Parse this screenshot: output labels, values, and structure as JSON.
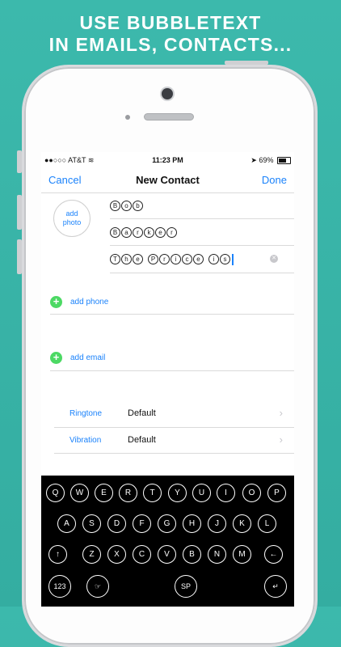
{
  "headline": {
    "line1": "USE BUBBLETEXT",
    "line2": "IN EMAILS, CONTACTS..."
  },
  "status": {
    "carrier": "●●○○○ AT&T",
    "time": "11:23 PM",
    "battery": "69%",
    "location_icon": "arrow-icon"
  },
  "nav": {
    "cancel": "Cancel",
    "title": "New Contact",
    "done": "Done"
  },
  "add_photo": {
    "line1": "add",
    "line2": "photo"
  },
  "fields": {
    "first": [
      "B",
      "o",
      "b"
    ],
    "last": [
      "B",
      "a",
      "r",
      "k",
      "e",
      "r"
    ],
    "company": [
      "T",
      "h",
      "e",
      "P",
      "r",
      "i",
      "c",
      "e",
      "i",
      "s"
    ]
  },
  "add_phone": "add phone",
  "add_email": "add email",
  "settings": [
    {
      "label": "Ringtone",
      "value": "Default"
    },
    {
      "label": "Vibration",
      "value": "Default"
    }
  ],
  "keyboard": {
    "row1": [
      "Q",
      "W",
      "E",
      "R",
      "T",
      "Y",
      "U",
      "I",
      "O",
      "P"
    ],
    "row2": [
      "A",
      "S",
      "D",
      "F",
      "G",
      "H",
      "J",
      "K",
      "L"
    ],
    "row3": [
      "Z",
      "X",
      "C",
      "V",
      "B",
      "N",
      "M"
    ],
    "shift": "↑",
    "backspace": "←",
    "numbers": "123",
    "emoji": "☞",
    "space": "SP",
    "return": "↵"
  }
}
